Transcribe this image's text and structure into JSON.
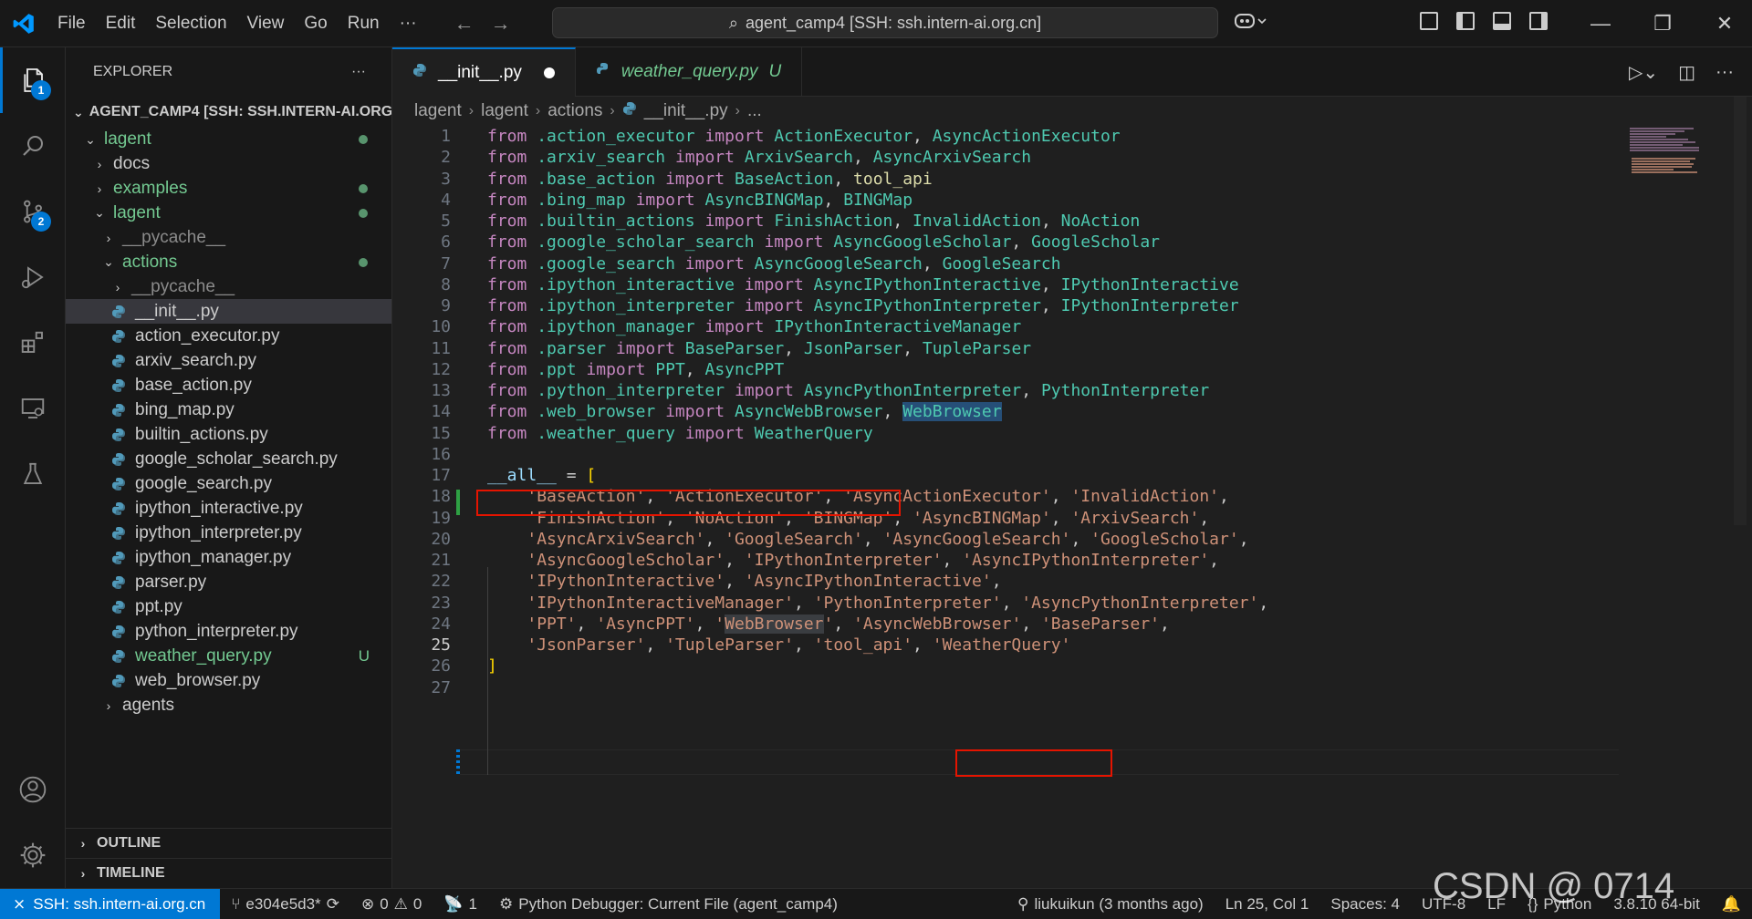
{
  "titlebar": {
    "menu": [
      "File",
      "Edit",
      "Selection",
      "View",
      "Go",
      "Run",
      "···"
    ],
    "search_text": "agent_camp4 [SSH: ssh.intern-ai.org.cn]"
  },
  "activity": {
    "explorer_badge": "1",
    "scm_badge": "2"
  },
  "sidebar": {
    "title": "EXPLORER",
    "more": "···",
    "root": "AGENT_CAMP4 [SSH: SSH.INTERN-AI.ORG....",
    "tree": [
      {
        "label": "lagent",
        "indent": 1,
        "chevron": "down",
        "color": "green",
        "dot": true
      },
      {
        "label": "docs",
        "indent": 2,
        "chevron": "right",
        "color": "default",
        "dot": false
      },
      {
        "label": "examples",
        "indent": 2,
        "chevron": "right",
        "color": "green",
        "dot": true
      },
      {
        "label": "lagent",
        "indent": 2,
        "chevron": "down",
        "color": "green",
        "dot": true
      },
      {
        "label": "__pycache__",
        "indent": 3,
        "chevron": "right",
        "color": "dim",
        "dot": false
      },
      {
        "label": "actions",
        "indent": 3,
        "chevron": "down",
        "color": "green",
        "dot": true
      },
      {
        "label": "__pycache__",
        "indent": 4,
        "chevron": "right",
        "color": "dim",
        "dot": false
      },
      {
        "label": "__init__.py",
        "indent": 4,
        "file": true,
        "color": "default",
        "selected": true
      },
      {
        "label": "action_executor.py",
        "indent": 4,
        "file": true,
        "color": "default"
      },
      {
        "label": "arxiv_search.py",
        "indent": 4,
        "file": true,
        "color": "default"
      },
      {
        "label": "base_action.py",
        "indent": 4,
        "file": true,
        "color": "default"
      },
      {
        "label": "bing_map.py",
        "indent": 4,
        "file": true,
        "color": "default"
      },
      {
        "label": "builtin_actions.py",
        "indent": 4,
        "file": true,
        "color": "default"
      },
      {
        "label": "google_scholar_search.py",
        "indent": 4,
        "file": true,
        "color": "default"
      },
      {
        "label": "google_search.py",
        "indent": 4,
        "file": true,
        "color": "default"
      },
      {
        "label": "ipython_interactive.py",
        "indent": 4,
        "file": true,
        "color": "default"
      },
      {
        "label": "ipython_interpreter.py",
        "indent": 4,
        "file": true,
        "color": "default"
      },
      {
        "label": "ipython_manager.py",
        "indent": 4,
        "file": true,
        "color": "default"
      },
      {
        "label": "parser.py",
        "indent": 4,
        "file": true,
        "color": "default"
      },
      {
        "label": "ppt.py",
        "indent": 4,
        "file": true,
        "color": "default"
      },
      {
        "label": "python_interpreter.py",
        "indent": 4,
        "file": true,
        "color": "default"
      },
      {
        "label": "weather_query.py",
        "indent": 4,
        "file": true,
        "color": "green",
        "badge": "U"
      },
      {
        "label": "web_browser.py",
        "indent": 4,
        "file": true,
        "color": "default"
      },
      {
        "label": "agents",
        "indent": 3,
        "chevron": "right",
        "color": "default"
      }
    ],
    "outline": "OUTLINE",
    "timeline": "TIMELINE"
  },
  "tabs": [
    {
      "label": "__init__.py",
      "active": true,
      "modified": true
    },
    {
      "label": "weather_query.py",
      "active": false,
      "badge": "U"
    }
  ],
  "breadcrumb": [
    "lagent",
    "lagent",
    "actions",
    "__init__.py",
    "..."
  ],
  "code": {
    "current_line": 25,
    "lines": [
      [
        [
          "kw",
          "from"
        ],
        [
          "pl",
          " "
        ],
        [
          "mod",
          ".action_executor"
        ],
        [
          "pl",
          " "
        ],
        [
          "kw",
          "import"
        ],
        [
          "pl",
          " "
        ],
        [
          "cls",
          "ActionExecutor"
        ],
        [
          "pl",
          ", "
        ],
        [
          "cls",
          "AsyncActionExecutor"
        ]
      ],
      [
        [
          "kw",
          "from"
        ],
        [
          "pl",
          " "
        ],
        [
          "mod",
          ".arxiv_search"
        ],
        [
          "pl",
          " "
        ],
        [
          "kw",
          "import"
        ],
        [
          "pl",
          " "
        ],
        [
          "cls",
          "ArxivSearch"
        ],
        [
          "pl",
          ", "
        ],
        [
          "cls",
          "AsyncArxivSearch"
        ]
      ],
      [
        [
          "kw",
          "from"
        ],
        [
          "pl",
          " "
        ],
        [
          "mod",
          ".base_action"
        ],
        [
          "pl",
          " "
        ],
        [
          "kw",
          "import"
        ],
        [
          "pl",
          " "
        ],
        [
          "cls",
          "BaseAction"
        ],
        [
          "pl",
          ", "
        ],
        [
          "fn",
          "tool_api"
        ]
      ],
      [
        [
          "kw",
          "from"
        ],
        [
          "pl",
          " "
        ],
        [
          "mod",
          ".bing_map"
        ],
        [
          "pl",
          " "
        ],
        [
          "kw",
          "import"
        ],
        [
          "pl",
          " "
        ],
        [
          "cls",
          "AsyncBINGMap"
        ],
        [
          "pl",
          ", "
        ],
        [
          "cls",
          "BINGMap"
        ]
      ],
      [
        [
          "kw",
          "from"
        ],
        [
          "pl",
          " "
        ],
        [
          "mod",
          ".builtin_actions"
        ],
        [
          "pl",
          " "
        ],
        [
          "kw",
          "import"
        ],
        [
          "pl",
          " "
        ],
        [
          "cls",
          "FinishAction"
        ],
        [
          "pl",
          ", "
        ],
        [
          "cls",
          "InvalidAction"
        ],
        [
          "pl",
          ", "
        ],
        [
          "cls",
          "NoAction"
        ]
      ],
      [
        [
          "kw",
          "from"
        ],
        [
          "pl",
          " "
        ],
        [
          "mod",
          ".google_scholar_search"
        ],
        [
          "pl",
          " "
        ],
        [
          "kw",
          "import"
        ],
        [
          "pl",
          " "
        ],
        [
          "cls",
          "AsyncGoogleScholar"
        ],
        [
          "pl",
          ", "
        ],
        [
          "cls",
          "GoogleScholar"
        ]
      ],
      [
        [
          "kw",
          "from"
        ],
        [
          "pl",
          " "
        ],
        [
          "mod",
          ".google_search"
        ],
        [
          "pl",
          " "
        ],
        [
          "kw",
          "import"
        ],
        [
          "pl",
          " "
        ],
        [
          "cls",
          "AsyncGoogleSearch"
        ],
        [
          "pl",
          ", "
        ],
        [
          "cls",
          "GoogleSearch"
        ]
      ],
      [
        [
          "kw",
          "from"
        ],
        [
          "pl",
          " "
        ],
        [
          "mod",
          ".ipython_interactive"
        ],
        [
          "pl",
          " "
        ],
        [
          "kw",
          "import"
        ],
        [
          "pl",
          " "
        ],
        [
          "cls",
          "AsyncIPythonInteractive"
        ],
        [
          "pl",
          ", "
        ],
        [
          "cls",
          "IPythonInteractive"
        ]
      ],
      [
        [
          "kw",
          "from"
        ],
        [
          "pl",
          " "
        ],
        [
          "mod",
          ".ipython_interpreter"
        ],
        [
          "pl",
          " "
        ],
        [
          "kw",
          "import"
        ],
        [
          "pl",
          " "
        ],
        [
          "cls",
          "AsyncIPythonInterpreter"
        ],
        [
          "pl",
          ", "
        ],
        [
          "cls",
          "IPythonInterpreter"
        ]
      ],
      [
        [
          "kw",
          "from"
        ],
        [
          "pl",
          " "
        ],
        [
          "mod",
          ".ipython_manager"
        ],
        [
          "pl",
          " "
        ],
        [
          "kw",
          "import"
        ],
        [
          "pl",
          " "
        ],
        [
          "cls",
          "IPythonInteractiveManager"
        ]
      ],
      [
        [
          "kw",
          "from"
        ],
        [
          "pl",
          " "
        ],
        [
          "mod",
          ".parser"
        ],
        [
          "pl",
          " "
        ],
        [
          "kw",
          "import"
        ],
        [
          "pl",
          " "
        ],
        [
          "cls",
          "BaseParser"
        ],
        [
          "pl",
          ", "
        ],
        [
          "cls",
          "JsonParser"
        ],
        [
          "pl",
          ", "
        ],
        [
          "cls",
          "TupleParser"
        ]
      ],
      [
        [
          "kw",
          "from"
        ],
        [
          "pl",
          " "
        ],
        [
          "mod",
          ".ppt"
        ],
        [
          "pl",
          " "
        ],
        [
          "kw",
          "import"
        ],
        [
          "pl",
          " "
        ],
        [
          "cls",
          "PPT"
        ],
        [
          "pl",
          ", "
        ],
        [
          "cls",
          "AsyncPPT"
        ]
      ],
      [
        [
          "kw",
          "from"
        ],
        [
          "pl",
          " "
        ],
        [
          "mod",
          ".python_interpreter"
        ],
        [
          "pl",
          " "
        ],
        [
          "kw",
          "import"
        ],
        [
          "pl",
          " "
        ],
        [
          "cls",
          "AsyncPythonInterpreter"
        ],
        [
          "pl",
          ", "
        ],
        [
          "cls",
          "PythonInterpreter"
        ]
      ],
      [
        [
          "kw",
          "from"
        ],
        [
          "pl",
          " "
        ],
        [
          "mod",
          ".web_browser"
        ],
        [
          "pl",
          " "
        ],
        [
          "kw",
          "import"
        ],
        [
          "pl",
          " "
        ],
        [
          "cls",
          "AsyncWebBrowser"
        ],
        [
          "pl",
          ", "
        ],
        [
          "cls hl",
          "WebBrowser"
        ]
      ],
      [
        [
          "kw",
          "from"
        ],
        [
          "pl",
          " "
        ],
        [
          "mod",
          ".weather_query"
        ],
        [
          "pl",
          " "
        ],
        [
          "kw",
          "import"
        ],
        [
          "pl",
          " "
        ],
        [
          "cls",
          "WeatherQuery"
        ]
      ],
      [],
      [
        [
          "var",
          "__all__"
        ],
        [
          "pl",
          " = "
        ],
        [
          "br",
          "["
        ]
      ],
      [
        [
          "pl",
          "    "
        ],
        [
          "str",
          "'BaseAction'"
        ],
        [
          "pl",
          ", "
        ],
        [
          "str",
          "'ActionExecutor'"
        ],
        [
          "pl",
          ", "
        ],
        [
          "str",
          "'AsyncActionExecutor'"
        ],
        [
          "pl",
          ", "
        ],
        [
          "str",
          "'InvalidAction'"
        ],
        [
          "pl",
          ","
        ]
      ],
      [
        [
          "pl",
          "    "
        ],
        [
          "str",
          "'FinishAction'"
        ],
        [
          "pl",
          ", "
        ],
        [
          "str",
          "'NoAction'"
        ],
        [
          "pl",
          ", "
        ],
        [
          "str",
          "'BINGMap'"
        ],
        [
          "pl",
          ", "
        ],
        [
          "str",
          "'AsyncBINGMap'"
        ],
        [
          "pl",
          ", "
        ],
        [
          "str",
          "'ArxivSearch'"
        ],
        [
          "pl",
          ","
        ]
      ],
      [
        [
          "pl",
          "    "
        ],
        [
          "str",
          "'AsyncArxivSearch'"
        ],
        [
          "pl",
          ", "
        ],
        [
          "str",
          "'GoogleSearch'"
        ],
        [
          "pl",
          ", "
        ],
        [
          "str",
          "'AsyncGoogleSearch'"
        ],
        [
          "pl",
          ", "
        ],
        [
          "str",
          "'GoogleScholar'"
        ],
        [
          "pl",
          ","
        ]
      ],
      [
        [
          "pl",
          "    "
        ],
        [
          "str",
          "'AsyncGoogleScholar'"
        ],
        [
          "pl",
          ", "
        ],
        [
          "str",
          "'IPythonInterpreter'"
        ],
        [
          "pl",
          ", "
        ],
        [
          "str",
          "'AsyncIPythonInterpreter'"
        ],
        [
          "pl",
          ","
        ]
      ],
      [
        [
          "pl",
          "    "
        ],
        [
          "str",
          "'IPythonInteractive'"
        ],
        [
          "pl",
          ", "
        ],
        [
          "str",
          "'AsyncIPythonInteractive'"
        ],
        [
          "pl",
          ","
        ]
      ],
      [
        [
          "pl",
          "    "
        ],
        [
          "str",
          "'IPythonInteractiveManager'"
        ],
        [
          "pl",
          ", "
        ],
        [
          "str",
          "'PythonInterpreter'"
        ],
        [
          "pl",
          ", "
        ],
        [
          "str",
          "'AsyncPythonInterpreter'"
        ],
        [
          "pl",
          ","
        ]
      ],
      [
        [
          "pl",
          "    "
        ],
        [
          "str",
          "'PPT'"
        ],
        [
          "pl",
          ", "
        ],
        [
          "str",
          "'AsyncPPT'"
        ],
        [
          "pl",
          ", "
        ],
        [
          "str",
          "'"
        ],
        [
          "str hl2",
          "WebBrowser"
        ],
        [
          "str",
          "'"
        ],
        [
          "pl",
          ", "
        ],
        [
          "str",
          "'AsyncWebBrowser'"
        ],
        [
          "pl",
          ", "
        ],
        [
          "str",
          "'BaseParser'"
        ],
        [
          "pl",
          ","
        ]
      ],
      [
        [
          "pl",
          "    "
        ],
        [
          "str",
          "'JsonParser'"
        ],
        [
          "pl",
          ", "
        ],
        [
          "str",
          "'TupleParser'"
        ],
        [
          "pl",
          ", "
        ],
        [
          "str",
          "'tool_api'"
        ],
        [
          "pl",
          ", "
        ],
        [
          "str",
          "'WeatherQuery'"
        ]
      ],
      [
        [
          "br",
          "]"
        ]
      ],
      []
    ]
  },
  "statusbar": {
    "remote": "SSH: ssh.intern-ai.org.cn",
    "branch": "e304e5d3*",
    "errors": "0",
    "warnings": "0",
    "ports": "1",
    "debugger": "Python Debugger: Current File (agent_camp4)",
    "blame": "liukuikun (3 months ago)",
    "position": "Ln 25, Col 1",
    "spaces": "Spaces: 4",
    "encoding": "UTF-8",
    "eol": "LF",
    "language": "Python",
    "interpreter": "3.8.10 64-bit"
  },
  "watermark": "CSDN @        0714"
}
